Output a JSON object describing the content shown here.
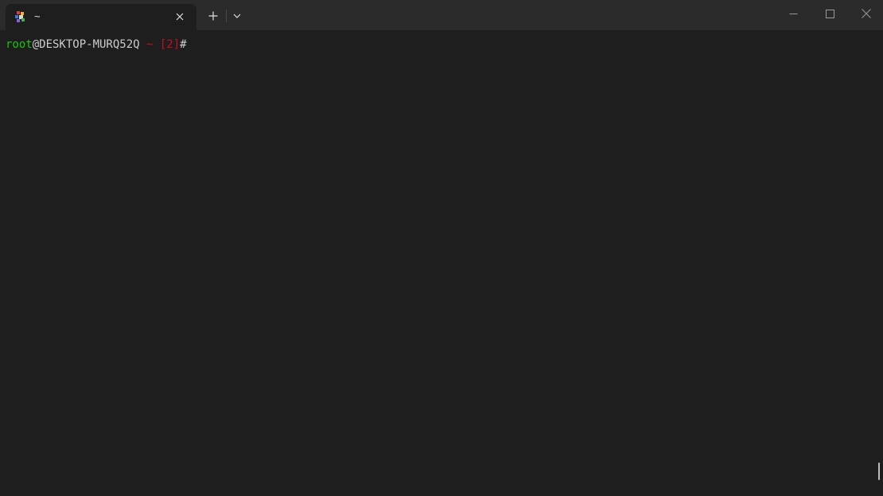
{
  "tab": {
    "icon": "linux-penguin-icon",
    "title": "~",
    "close_icon": "close-icon"
  },
  "tabbar": {
    "new_tab_icon": "plus-icon",
    "dropdown_icon": "chevron-down-icon"
  },
  "window_controls": {
    "minimize_icon": "minimize-icon",
    "maximize_icon": "maximize-icon",
    "close_icon": "close-icon"
  },
  "terminal": {
    "prompt": {
      "user": "root",
      "host": "@DESKTOP-MURQ52Q",
      "cwd": " ~ ",
      "status": "[2]",
      "symbol": "#"
    }
  },
  "colors": {
    "titlebar_bg": "#2b2b2b",
    "terminal_bg": "#1e1e1e",
    "user_green": "#16c60c",
    "status_red": "#c50f1f",
    "text_default": "#cccccc"
  }
}
